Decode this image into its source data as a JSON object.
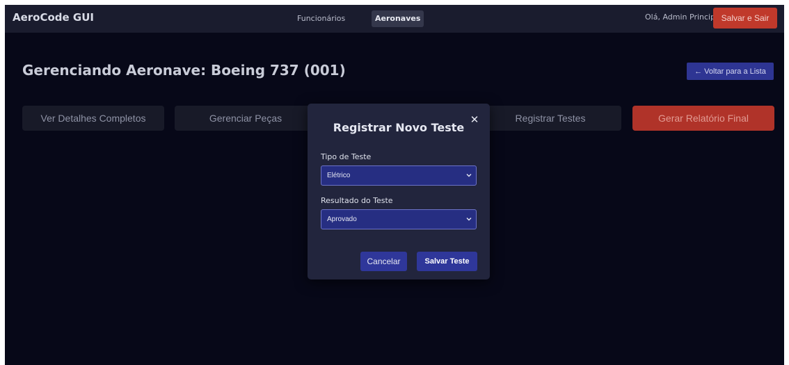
{
  "navbar": {
    "brand": "AeroCode GUI",
    "links": [
      {
        "label": "Funcionários",
        "active": false
      },
      {
        "label": "Aeronaves",
        "active": true
      }
    ],
    "greeting": "Olá, Admin Principal",
    "exit_label": "Salvar e Sair"
  },
  "page": {
    "title": "Gerenciando Aeronave: Boeing 737 (001)",
    "back_label": "← Voltar para a Lista",
    "tabs": [
      {
        "label": "Ver Detalhes Completos"
      },
      {
        "label": "Gerenciar Peças"
      },
      {
        "label": "Registrar Testes"
      },
      {
        "label": "Gerar Relatório Final"
      }
    ]
  },
  "modal": {
    "title": "Registrar Novo Teste",
    "close_icon": "close-icon",
    "test_type": {
      "label": "Tipo de Teste",
      "value": "Elétrico"
    },
    "test_result": {
      "label": "Resultado do Teste",
      "value": "Aprovado"
    },
    "cancel_label": "Cancelar",
    "save_label": "Salvar Teste"
  },
  "colors": {
    "background": "#070818",
    "navbar": "#1a1c2e",
    "danger": "#c0392b",
    "primary": "#2e3593",
    "modal": "#22253d"
  }
}
